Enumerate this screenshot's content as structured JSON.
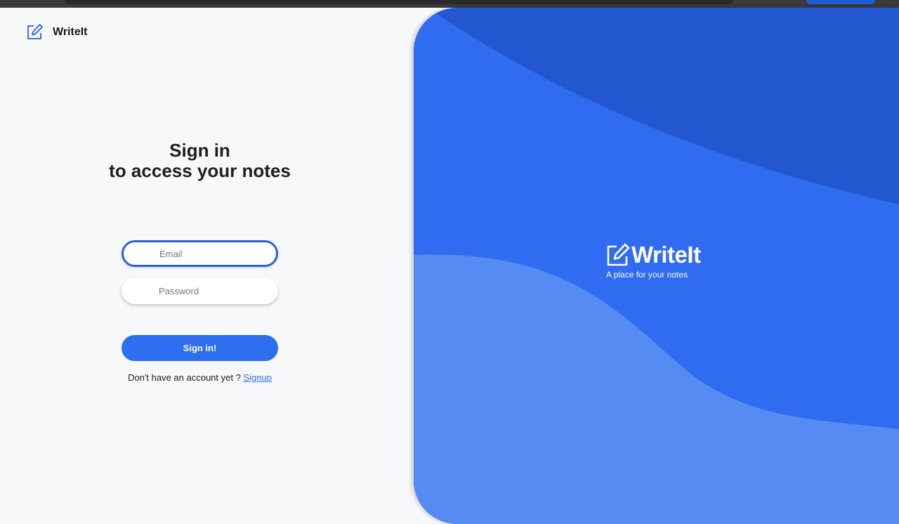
{
  "app": {
    "name": "WriteIt",
    "logo_icon": "edit-note-icon"
  },
  "signin": {
    "heading_line1": "Sign in",
    "heading_line2": "to access your notes",
    "email_placeholder": "Email",
    "email_value": "",
    "password_placeholder": "Password",
    "password_value": "",
    "submit_label": "Sign in!",
    "signup_prompt": "Don't have an account yet ?",
    "signup_link": "Signup"
  },
  "hero": {
    "title": "WriteIt",
    "tagline": "A place for your notes",
    "logo_icon": "edit-note-icon"
  },
  "colors": {
    "accent": "#2e6ef0",
    "hero_dark": "#2357cf",
    "hero_mid": "#306cf1",
    "hero_light": "#568bf3",
    "page_bg": "#f7f8f9"
  }
}
